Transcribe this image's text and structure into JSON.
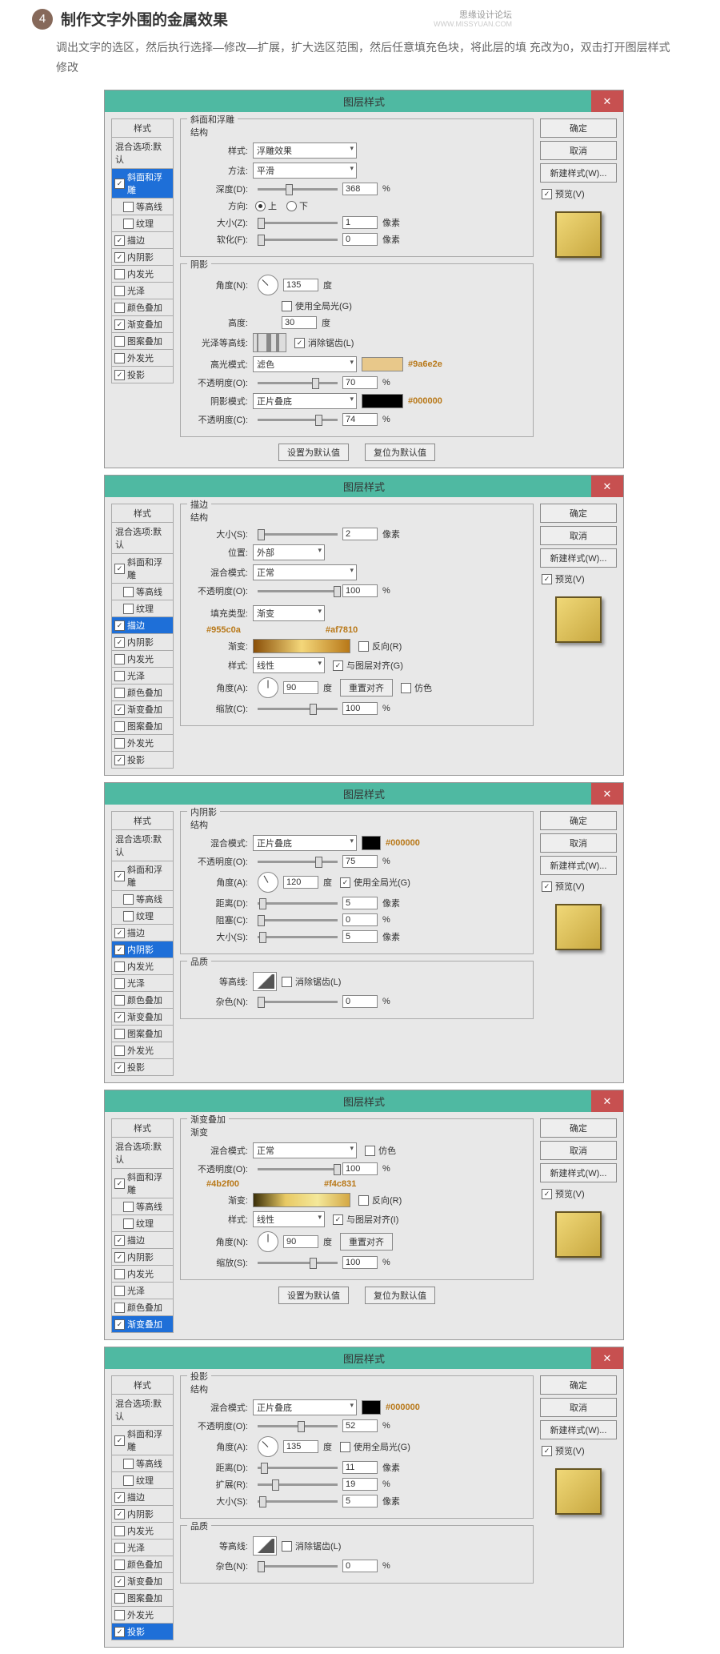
{
  "header": {
    "step": "4",
    "title": "制作文字外围的金属效果",
    "watermark": "思缘设计论坛",
    "watermark2": "WWW.MISSYUAN.COM"
  },
  "desc": "调出文字的选区，然后执行选择—修改—扩展，扩大选区范围，然后任意填充色块，将此层的填 充改为0，双击打开图层样式修改",
  "common": {
    "dlgTitle": "图层样式",
    "close": "✕",
    "styleHdr": "样式",
    "styleSub": "混合选项:默认",
    "ok": "确定",
    "cancel": "取消",
    "newStyle": "新建样式(W)...",
    "preview": "预览(V)",
    "setDefault": "设置为默认值",
    "resetDefault": "复位为默认值",
    "items": {
      "bevel": "斜面和浮雕",
      "contour": "等高线",
      "texture": "纹理",
      "stroke": "描边",
      "innerShadow": "内阴影",
      "innerGlow": "内发光",
      "satin": "光泽",
      "colorOverlay": "颜色叠加",
      "gradOverlay": "渐变叠加",
      "patOverlay": "图案叠加",
      "outerGlow": "外发光",
      "dropShadow": "投影"
    }
  },
  "d1": {
    "g1": "斜面和浮雕",
    "g1s": "结构",
    "g2": "阴影",
    "style": "样式:",
    "styleV": "浮雕效果",
    "tech": "方法:",
    "techV": "平滑",
    "depth": "深度(D):",
    "depthV": "368",
    "dir": "方向:",
    "up": "上",
    "down": "下",
    "size": "大小(Z):",
    "sizeV": "1",
    "soft": "软化(F):",
    "softV": "0",
    "px": "像素",
    "pct": "%",
    "angle": "角度(N):",
    "angleV": "135",
    "deg": "度",
    "global": "使用全局光(G)",
    "alt": "高度:",
    "altV": "30",
    "gloss": "光泽等高线:",
    "anti": "消除锯齿(L)",
    "hiMode": "高光模式:",
    "hiV": "滤色",
    "hiHex": "#9a6e2e",
    "hiOp": "不透明度(O):",
    "hiOpV": "70",
    "shMode": "阴影模式:",
    "shV": "正片叠底",
    "shHex": "#000000",
    "shOp": "不透明度(C):",
    "shOpV": "74"
  },
  "d2": {
    "g1": "描边",
    "g1s": "结构",
    "size": "大小(S):",
    "sizeV": "2",
    "px": "像素",
    "pos": "位置:",
    "posV": "外部",
    "blend": "混合模式:",
    "blendV": "正常",
    "op": "不透明度(O):",
    "opV": "100",
    "pct": "%",
    "fillType": "填充类型:",
    "fillV": "渐变",
    "hex1": "#955c0a",
    "hex2": "#af7810",
    "grad": "渐变:",
    "rev": "反向(R)",
    "style": "样式:",
    "styleV": "线性",
    "align": "与图层对齐(G)",
    "angle": "角度(A):",
    "angleV": "90",
    "deg": "度",
    "reset": "重置对齐",
    "dither": "仿色",
    "scale": "缩放(C):",
    "scaleV": "100"
  },
  "d3": {
    "g1": "内阴影",
    "g1s": "结构",
    "blend": "混合模式:",
    "blendV": "正片叠底",
    "hex": "#000000",
    "op": "不透明度(O):",
    "opV": "75",
    "pct": "%",
    "angle": "角度(A):",
    "angleV": "120",
    "deg": "度",
    "global": "使用全局光(G)",
    "dist": "距离(D):",
    "distV": "5",
    "px": "像素",
    "choke": "阻塞(C):",
    "chokeV": "0",
    "size": "大小(S):",
    "sizeV": "5",
    "g2": "品质",
    "contour": "等高线:",
    "anti": "消除锯齿(L)",
    "noise": "杂色(N):",
    "noiseV": "0"
  },
  "d4": {
    "g1": "渐变叠加",
    "g1s": "渐变",
    "blend": "混合模式:",
    "blendV": "正常",
    "dither": "仿色",
    "op": "不透明度(O):",
    "opV": "100",
    "pct": "%",
    "hex1": "#4b2f00",
    "hex2": "#f4c831",
    "grad": "渐变:",
    "rev": "反向(R)",
    "style": "样式:",
    "styleV": "线性",
    "align": "与图层对齐(I)",
    "angle": "角度(N):",
    "angleV": "90",
    "deg": "度",
    "reset": "重置对齐",
    "scale": "缩放(S):",
    "scaleV": "100"
  },
  "d5": {
    "g1": "投影",
    "g1s": "结构",
    "blend": "混合模式:",
    "blendV": "正片叠底",
    "hex": "#000000",
    "op": "不透明度(O):",
    "opV": "52",
    "pct": "%",
    "angle": "角度(A):",
    "angleV": "135",
    "deg": "度",
    "global": "使用全局光(G)",
    "dist": "距离(D):",
    "distV": "11",
    "px": "像素",
    "spread": "扩展(R):",
    "spreadV": "19",
    "size": "大小(S):",
    "sizeV": "5",
    "g2": "品质",
    "contour": "等高线:",
    "anti": "消除锯齿(L)",
    "noise": "杂色(N):",
    "noiseV": "0"
  }
}
